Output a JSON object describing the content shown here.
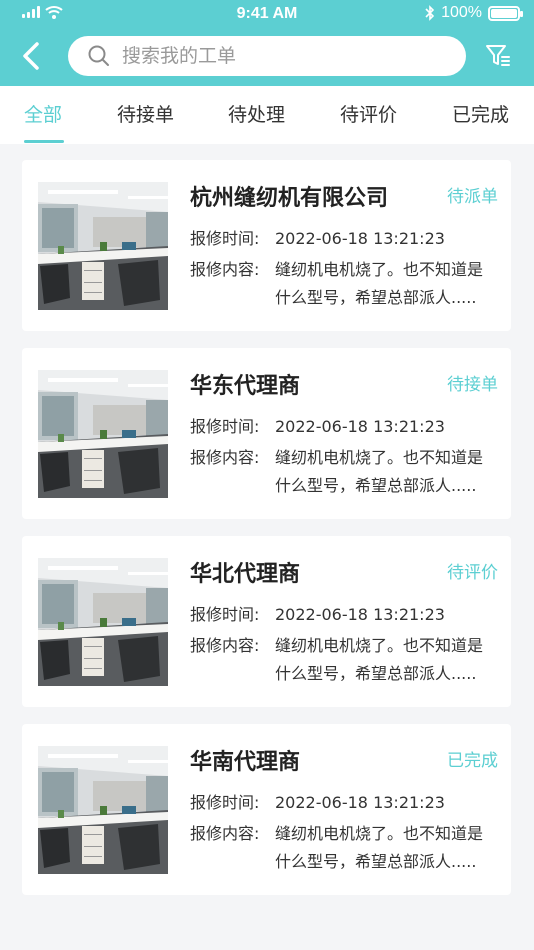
{
  "status_bar": {
    "time": "9:41 AM",
    "battery": "100%",
    "battery_level": 1.0
  },
  "search": {
    "placeholder": "搜索我的工单",
    "value": ""
  },
  "tabs": [
    {
      "label": "全部",
      "active": true
    },
    {
      "label": "待接单",
      "active": false
    },
    {
      "label": "待处理",
      "active": false
    },
    {
      "label": "待评价",
      "active": false
    },
    {
      "label": "已完成",
      "active": false
    }
  ],
  "orders": [
    {
      "title": "杭州缝纫机有限公司",
      "status": "待派单",
      "time_label": "报修时间:",
      "time": "2022-06-18  13:21:23",
      "content_label": "报修内容:",
      "content_line1": "缝纫机电机烧了。也不知道是",
      "content_line2": "什么型号，希望总部派人....."
    },
    {
      "title": "华东代理商",
      "status": "待接单",
      "time_label": "报修时间:",
      "time": "2022-06-18  13:21:23",
      "content_label": "报修内容:",
      "content_line1": "缝纫机电机烧了。也不知道是",
      "content_line2": "什么型号，希望总部派人....."
    },
    {
      "title": "华北代理商",
      "status": "待评价",
      "time_label": "报修时间:",
      "time": "2022-06-18  13:21:23",
      "content_label": "报修内容:",
      "content_line1": "缝纫机电机烧了。也不知道是",
      "content_line2": "什么型号，希望总部派人....."
    },
    {
      "title": "华南代理商",
      "status": "已完成",
      "time_label": "报修时间:",
      "time": "2022-06-18  13:21:23",
      "content_label": "报修内容:",
      "content_line1": "缝纫机电机烧了。也不知道是",
      "content_line2": "什么型号，希望总部派人....."
    }
  ],
  "colors": {
    "accent": "#5ccfd2",
    "background": "#f4f5f7"
  }
}
